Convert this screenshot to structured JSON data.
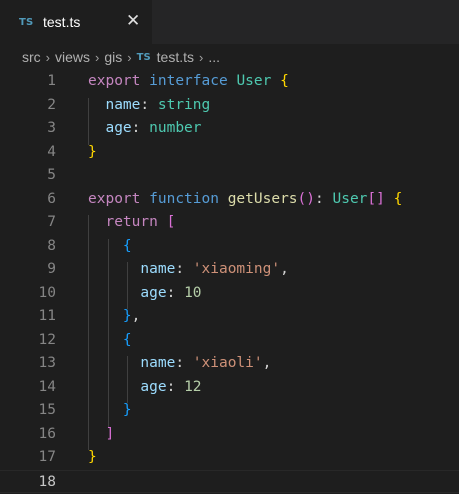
{
  "tab": {
    "language_badge": "TS",
    "title": "test.ts",
    "close_glyph": "✕"
  },
  "breadcrumb": {
    "items": [
      "src",
      "views",
      "gis"
    ],
    "file_badge": "TS",
    "file": "test.ts",
    "more": "...",
    "separator": "›"
  },
  "editor": {
    "current_line": 18,
    "lines": [
      {
        "n": "1",
        "tokens": [
          [
            "kw",
            "export"
          ],
          [
            "p",
            " "
          ],
          [
            "kw2",
            "interface"
          ],
          [
            "p",
            " "
          ],
          [
            "type",
            "User"
          ],
          [
            "p",
            " "
          ],
          [
            "b1",
            "{"
          ]
        ]
      },
      {
        "n": "2",
        "tokens": [
          [
            "p",
            "  "
          ],
          [
            "prop",
            "name"
          ],
          [
            "p",
            ": "
          ],
          [
            "type",
            "string"
          ]
        ]
      },
      {
        "n": "3",
        "tokens": [
          [
            "p",
            "  "
          ],
          [
            "prop",
            "age"
          ],
          [
            "p",
            ": "
          ],
          [
            "type",
            "number"
          ]
        ]
      },
      {
        "n": "4",
        "tokens": [
          [
            "b1",
            "}"
          ]
        ]
      },
      {
        "n": "5",
        "tokens": []
      },
      {
        "n": "6",
        "tokens": [
          [
            "kw",
            "export"
          ],
          [
            "p",
            " "
          ],
          [
            "kw2",
            "function"
          ],
          [
            "p",
            " "
          ],
          [
            "fn",
            "getUsers"
          ],
          [
            "b2",
            "()"
          ],
          [
            "p",
            ": "
          ],
          [
            "type",
            "User"
          ],
          [
            "b2",
            "[]"
          ],
          [
            "p",
            " "
          ],
          [
            "b1",
            "{"
          ]
        ]
      },
      {
        "n": "7",
        "tokens": [
          [
            "p",
            "  "
          ],
          [
            "kw",
            "return"
          ],
          [
            "p",
            " "
          ],
          [
            "b2",
            "["
          ]
        ]
      },
      {
        "n": "8",
        "tokens": [
          [
            "p",
            "    "
          ],
          [
            "b3",
            "{"
          ]
        ]
      },
      {
        "n": "9",
        "tokens": [
          [
            "p",
            "      "
          ],
          [
            "prop",
            "name"
          ],
          [
            "p",
            ": "
          ],
          [
            "str",
            "'xiaoming'"
          ],
          [
            "p",
            ","
          ]
        ]
      },
      {
        "n": "10",
        "tokens": [
          [
            "p",
            "      "
          ],
          [
            "prop",
            "age"
          ],
          [
            "p",
            ": "
          ],
          [
            "num",
            "10"
          ]
        ]
      },
      {
        "n": "11",
        "tokens": [
          [
            "p",
            "    "
          ],
          [
            "b3",
            "}"
          ],
          [
            "p",
            ","
          ]
        ]
      },
      {
        "n": "12",
        "tokens": [
          [
            "p",
            "    "
          ],
          [
            "b3",
            "{"
          ]
        ]
      },
      {
        "n": "13",
        "tokens": [
          [
            "p",
            "      "
          ],
          [
            "prop",
            "name"
          ],
          [
            "p",
            ": "
          ],
          [
            "str",
            "'xiaoli'"
          ],
          [
            "p",
            ","
          ]
        ]
      },
      {
        "n": "14",
        "tokens": [
          [
            "p",
            "      "
          ],
          [
            "prop",
            "age"
          ],
          [
            "p",
            ": "
          ],
          [
            "num",
            "12"
          ]
        ]
      },
      {
        "n": "15",
        "tokens": [
          [
            "p",
            "    "
          ],
          [
            "b3",
            "}"
          ]
        ]
      },
      {
        "n": "16",
        "tokens": [
          [
            "p",
            "  "
          ],
          [
            "b2",
            "]"
          ]
        ]
      },
      {
        "n": "17",
        "tokens": [
          [
            "b1",
            "}"
          ]
        ]
      },
      {
        "n": "18",
        "tokens": []
      }
    ]
  },
  "colors": {
    "background": "#1e1e1e",
    "tabbar": "#252526",
    "ts_badge": "#519aba",
    "keyword": "#c586c0",
    "storage": "#569cd6",
    "type": "#4ec9b0",
    "property": "#9cdcfe",
    "string": "#ce9178",
    "number": "#b5cea8",
    "function": "#dcdcaa"
  }
}
